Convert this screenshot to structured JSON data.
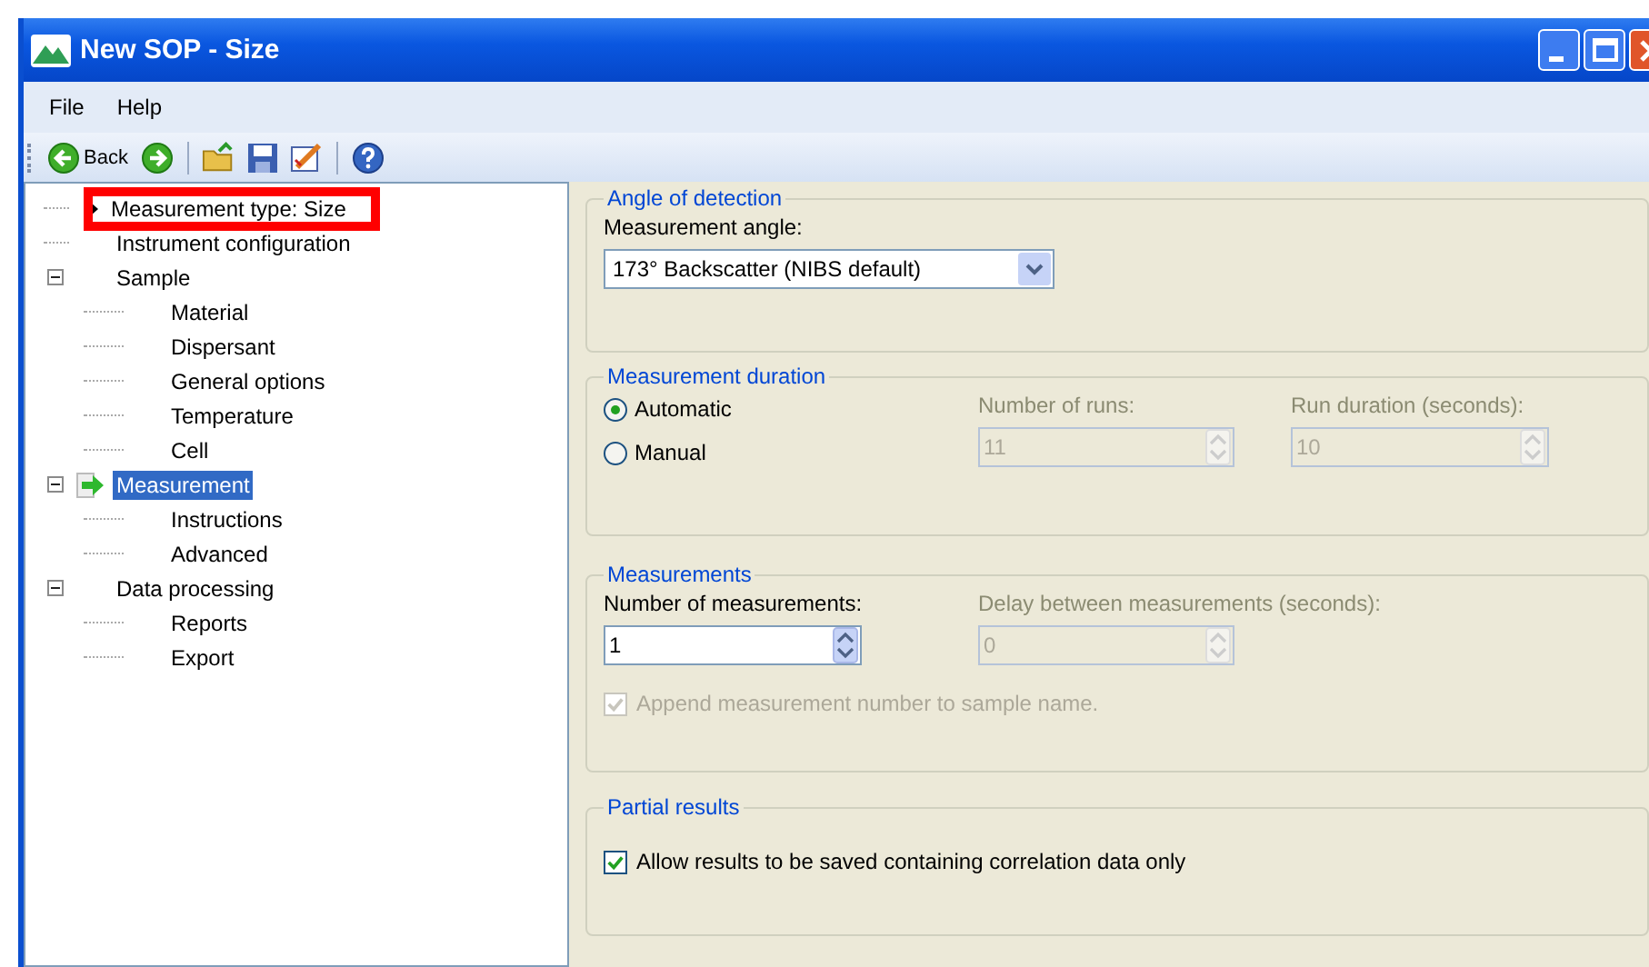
{
  "window": {
    "title": "New SOP - Size"
  },
  "menu": [
    {
      "label": "File"
    },
    {
      "label": "Help"
    }
  ],
  "toolbar": {
    "back_label": "Back"
  },
  "tree": [
    {
      "label": "Measurement type: Size",
      "selected": false,
      "highlighted": true,
      "pointer": true,
      "current": false
    },
    {
      "label": "Instrument configuration",
      "selected": false,
      "highlighted": false,
      "pointer": false,
      "current": false
    },
    {
      "label": "Sample",
      "selected": false,
      "highlighted": false,
      "pointer": false,
      "current": false,
      "expanded": true,
      "children": [
        {
          "label": "Material",
          "selected": false
        },
        {
          "label": "Dispersant",
          "selected": false
        },
        {
          "label": "General options",
          "selected": false
        },
        {
          "label": "Temperature",
          "selected": false
        },
        {
          "label": "Cell",
          "selected": false
        }
      ]
    },
    {
      "label": "Measurement",
      "selected": true,
      "highlighted": false,
      "pointer": false,
      "current": true,
      "expanded": true,
      "children": [
        {
          "label": "Instructions",
          "selected": false
        },
        {
          "label": "Advanced",
          "selected": false
        }
      ]
    },
    {
      "label": "Data processing",
      "selected": false,
      "highlighted": false,
      "pointer": false,
      "current": false,
      "expanded": true,
      "children": [
        {
          "label": "Reports",
          "selected": false
        },
        {
          "label": "Export",
          "selected": false
        }
      ]
    }
  ],
  "angle_of_detection": {
    "title": "Angle of detection",
    "angle_label": "Measurement angle:",
    "angle_value": "173° Backscatter (NIBS default)"
  },
  "measurement_duration": {
    "title": "Measurement duration",
    "modes": [
      {
        "label": "Automatic",
        "selected": true
      },
      {
        "label": "Manual",
        "selected": false
      }
    ],
    "runs": {
      "label": "Number of runs:",
      "value": "11",
      "disabled": true
    },
    "run_duration": {
      "label": "Run duration (seconds):",
      "value": "10",
      "disabled": true
    }
  },
  "measurements": {
    "title": "Measurements",
    "count": {
      "label": "Number of measurements:",
      "value": "1",
      "disabled": false
    },
    "delay": {
      "label": "Delay between measurements (seconds):",
      "value": "0",
      "disabled": true
    },
    "append": {
      "label": "Append measurement number to sample name.",
      "checked": true,
      "disabled": true
    }
  },
  "partial_results": {
    "title": "Partial results",
    "allow": {
      "label": "Allow results to be saved containing correlation data only",
      "checked": true,
      "disabled": false
    }
  }
}
